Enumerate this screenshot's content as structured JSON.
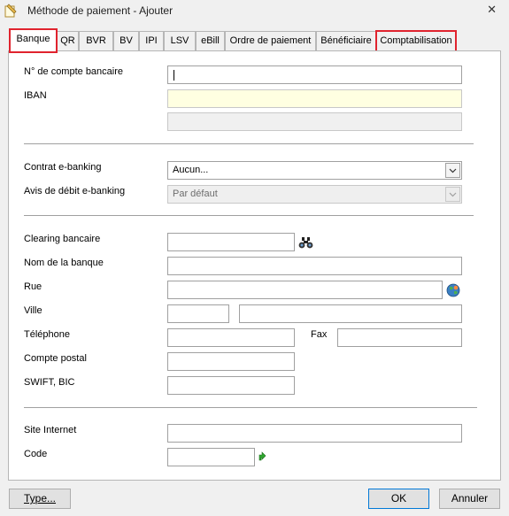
{
  "window": {
    "title": "Méthode de paiement - Ajouter",
    "close_glyph": "✕"
  },
  "tabs": [
    {
      "label": "Banque",
      "active": true,
      "highlighted": true
    },
    {
      "label": "QR"
    },
    {
      "label": "BVR"
    },
    {
      "label": "BV"
    },
    {
      "label": "IPI"
    },
    {
      "label": "LSV"
    },
    {
      "label": "eBill"
    },
    {
      "label": "Ordre de paiement"
    },
    {
      "label": "Bénéficiaire"
    },
    {
      "label": "Comptabilisation",
      "highlighted": true
    }
  ],
  "highlight_color": "#e0232e",
  "form": {
    "account_number_label": "N° de compte bancaire",
    "account_number_value": "",
    "iban_label": "IBAN",
    "iban_value": "",
    "iban_extra_value": "",
    "contract_label": "Contrat e-banking",
    "contract_value": "Aucun...",
    "debit_notice_label": "Avis de débit e-banking",
    "debit_notice_value": "Par défaut",
    "clearing_label": "Clearing bancaire",
    "clearing_value": "",
    "bank_name_label": "Nom de la banque",
    "bank_name_value": "",
    "street_label": "Rue",
    "street_value": "",
    "city_label": "Ville",
    "zip_value": "",
    "city_value": "",
    "phone_label": "Téléphone",
    "phone_value": "",
    "fax_label": "Fax",
    "fax_value": "",
    "postal_account_label": "Compte postal",
    "postal_account_value": "",
    "swift_label": "SWIFT, BIC",
    "swift_value": "",
    "website_label": "Site Internet",
    "website_value": "",
    "code_label": "Code",
    "code_value": ""
  },
  "icons": {
    "search": "binoculars-icon",
    "globe": "globe-icon",
    "code": "green-arrow-icon"
  },
  "footer": {
    "type_button": "Type...",
    "ok_button": "OK",
    "cancel_button": "Annuler"
  }
}
